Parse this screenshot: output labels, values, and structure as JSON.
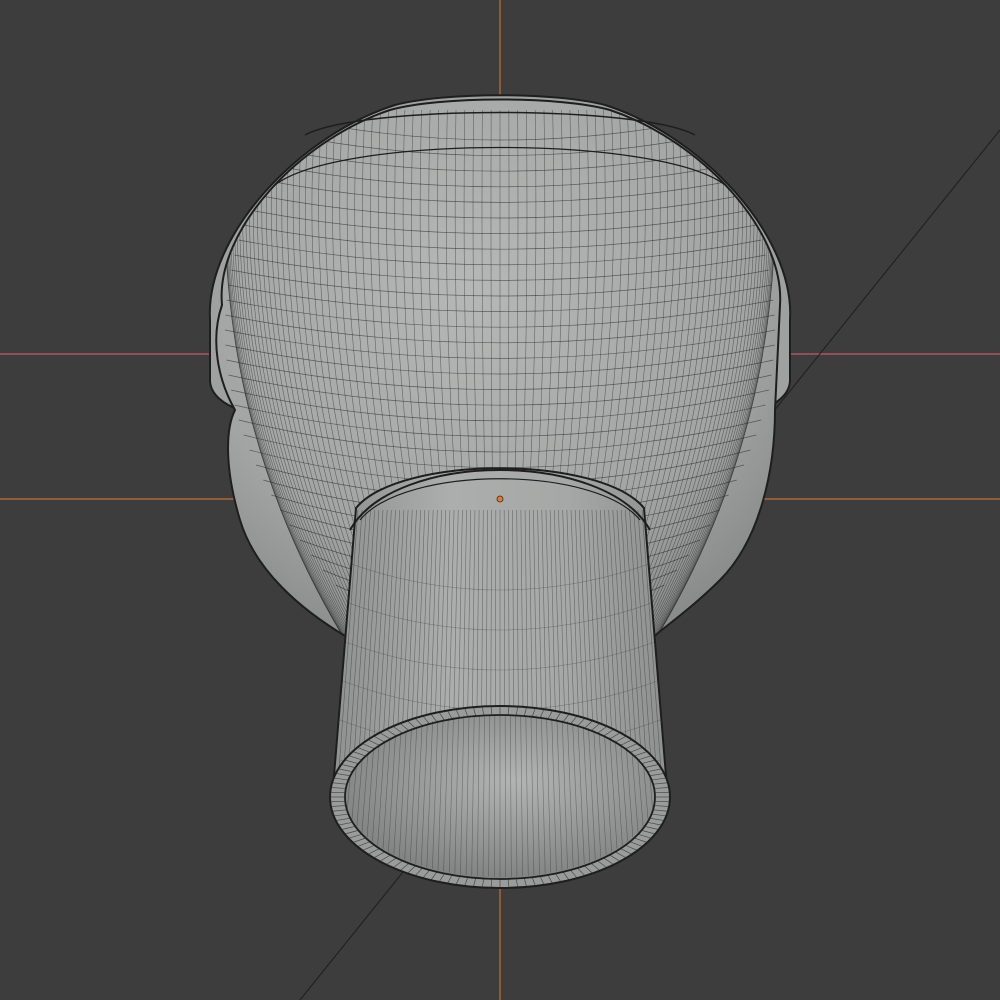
{
  "viewport": {
    "background": "#3d3d3d",
    "mode": "wireframe-overlay",
    "axis_colors": {
      "x_axis": "#e06a7a",
      "y_axis": "#d97c3a",
      "z_axis": "#d97c3a"
    },
    "mesh_fill": "#a8a9a9",
    "wire_color": "#2a2a2a",
    "origin_color": "#e07b30"
  },
  "object": {
    "shape": "lathe-revolved-mesh",
    "icon": "mesh-object-icon"
  }
}
